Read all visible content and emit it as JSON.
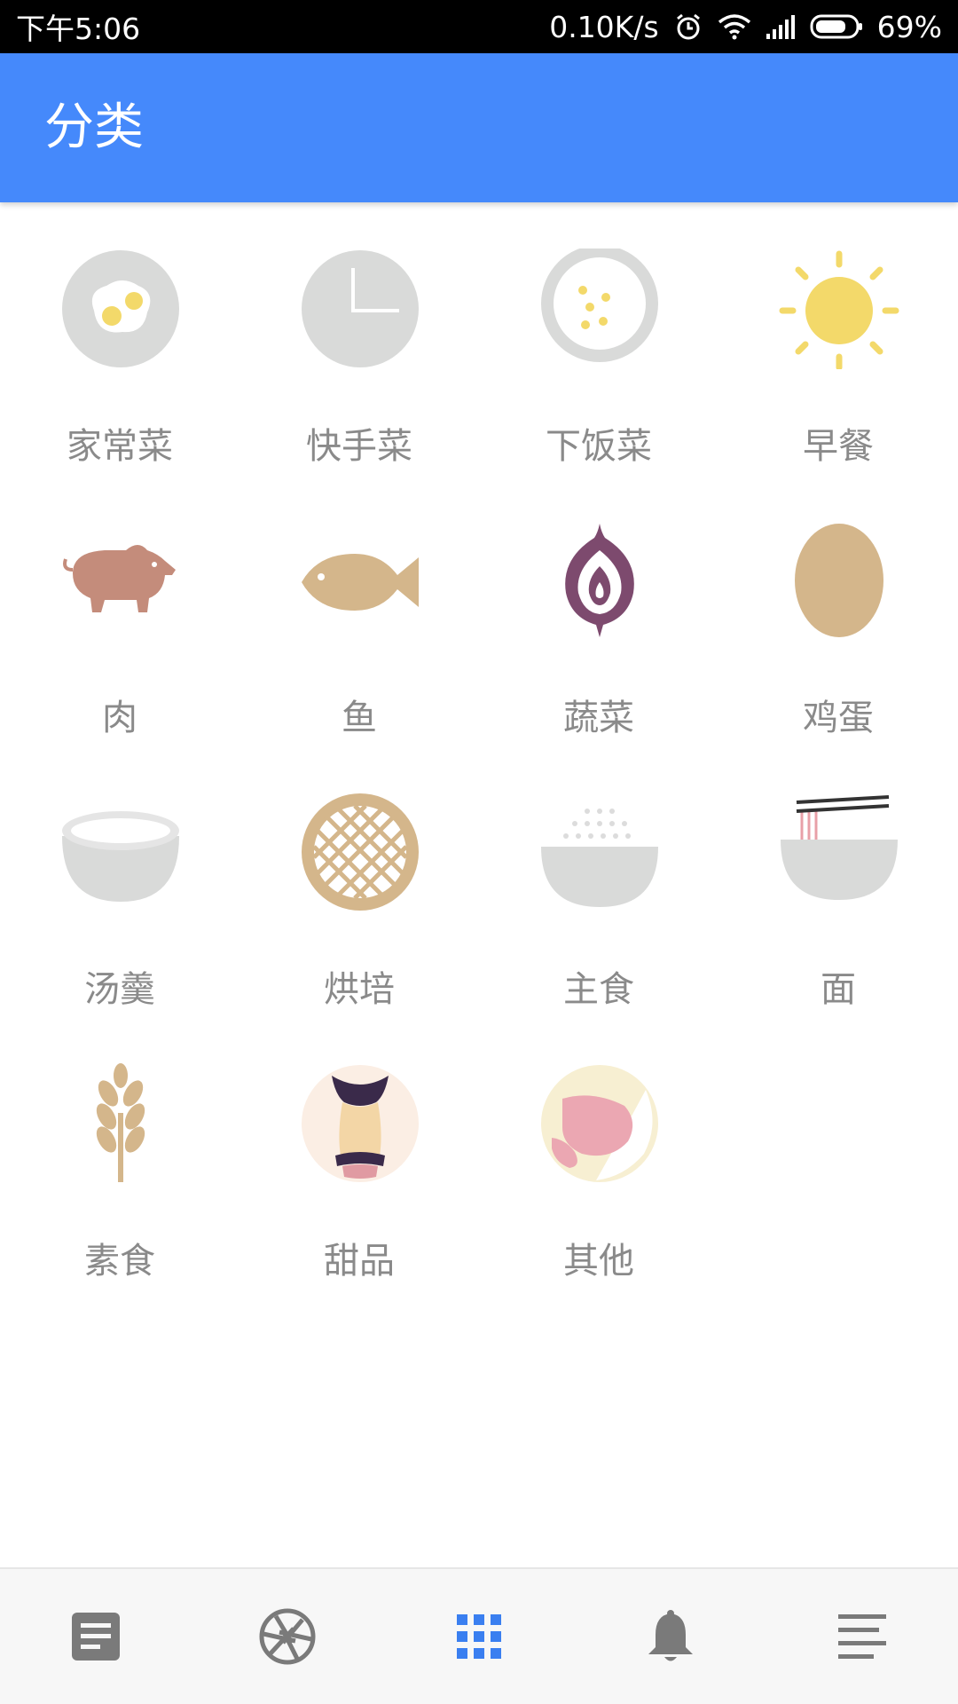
{
  "status_bar": {
    "time": "下午5:06",
    "net_speed": "0.10K/s",
    "battery": "69%",
    "icons": [
      "alarm-icon",
      "wifi-icon",
      "signal-icon",
      "battery-icon"
    ]
  },
  "app_bar": {
    "title": "分类"
  },
  "categories": [
    {
      "label": "家常菜",
      "icon": "fried-egg-icon"
    },
    {
      "label": "快手菜",
      "icon": "clock-icon"
    },
    {
      "label": "下饭菜",
      "icon": "plate-icon"
    },
    {
      "label": "早餐",
      "icon": "sun-icon"
    },
    {
      "label": "肉",
      "icon": "pig-icon"
    },
    {
      "label": "鱼",
      "icon": "fish-icon"
    },
    {
      "label": "蔬菜",
      "icon": "onion-icon"
    },
    {
      "label": "鸡蛋",
      "icon": "egg-icon"
    },
    {
      "label": "汤羹",
      "icon": "soup-bowl-icon"
    },
    {
      "label": "烘培",
      "icon": "pie-icon"
    },
    {
      "label": "主食",
      "icon": "rice-bowl-icon"
    },
    {
      "label": "面",
      "icon": "noodle-bowl-icon"
    },
    {
      "label": "素食",
      "icon": "wheat-icon"
    },
    {
      "label": "甜品",
      "icon": "dessert-icon"
    },
    {
      "label": "其他",
      "icon": "other-icon"
    }
  ],
  "bottom_nav": [
    {
      "name": "nav-feed",
      "icon": "document-icon",
      "active": false
    },
    {
      "name": "nav-camera",
      "icon": "aperture-icon",
      "active": false
    },
    {
      "name": "nav-categories",
      "icon": "grid-icon",
      "active": true
    },
    {
      "name": "nav-notifications",
      "icon": "bell-icon",
      "active": false
    },
    {
      "name": "nav-menu",
      "icon": "menu-lines-icon",
      "active": false
    }
  ],
  "colors": {
    "app_bar": "#4589fb",
    "active_nav": "#3a7ff0",
    "inactive_nav": "#7a7a7a",
    "label_text": "#8a8a8a"
  }
}
